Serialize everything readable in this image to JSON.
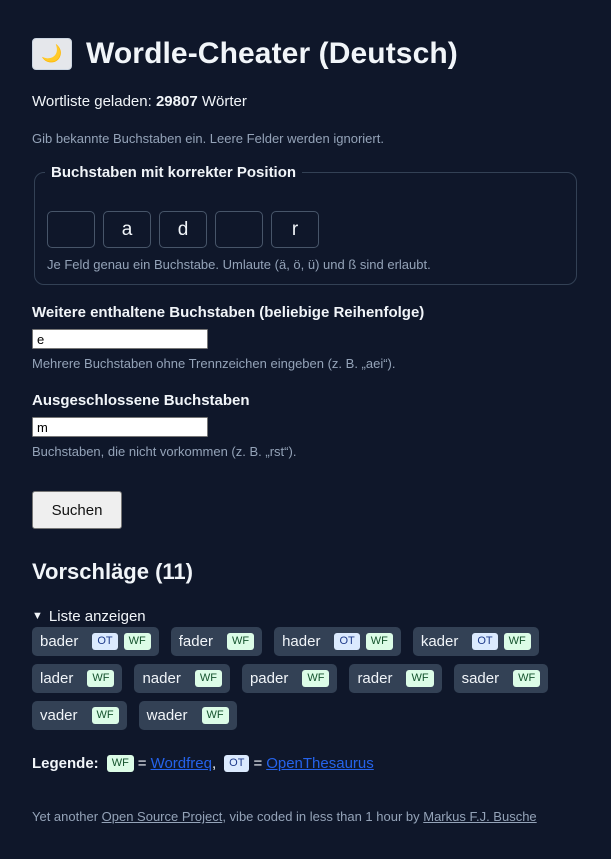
{
  "header": {
    "icon": "moon-icon",
    "icon_glyph": "🌙",
    "title": "Wordle-Cheater (Deutsch)"
  },
  "wordlist": {
    "prefix": "Wortliste geladen: ",
    "count": "29807",
    "suffix": " Wörter"
  },
  "instructions": "Gib bekannte Buchstaben ein. Leere Felder werden ignoriert.",
  "positions": {
    "legend": "Buchstaben mit korrekter Position",
    "slots": [
      "",
      "a",
      "d",
      "",
      "r"
    ],
    "hint": "Je Feld genau ein Buchstabe. Umlaute (ä, ö, ü) und ß sind erlaubt."
  },
  "included": {
    "label": "Weitere enthaltene Buchstaben (beliebige Reihenfolge)",
    "value": "e",
    "hint": "Mehrere Buchstaben ohne Trennzeichen eingeben (z. B. „aei“)."
  },
  "excluded": {
    "label": "Ausgeschlossene Buchstaben",
    "value": "m",
    "hint": "Buchstaben, die nicht vorkommen (z. B. „rst“)."
  },
  "search_button": "Suchen",
  "results": {
    "heading": "Vorschläge (11)",
    "toggle": "Liste anzeigen",
    "words": [
      {
        "word": "bader",
        "badges": [
          "OT",
          "WF"
        ]
      },
      {
        "word": "fader",
        "badges": [
          "WF"
        ]
      },
      {
        "word": "hader",
        "badges": [
          "OT",
          "WF"
        ]
      },
      {
        "word": "kader",
        "badges": [
          "OT",
          "WF"
        ]
      },
      {
        "word": "lader",
        "badges": [
          "WF"
        ]
      },
      {
        "word": "nader",
        "badges": [
          "WF"
        ]
      },
      {
        "word": "pader",
        "badges": [
          "WF"
        ]
      },
      {
        "word": "rader",
        "badges": [
          "WF"
        ]
      },
      {
        "word": "sader",
        "badges": [
          "WF"
        ]
      },
      {
        "word": "vader",
        "badges": [
          "WF"
        ]
      },
      {
        "word": "wader",
        "badges": [
          "WF"
        ]
      }
    ]
  },
  "legend": {
    "label": "Legende:",
    "wf_badge": "WF",
    "wf_link": "Wordfreq",
    "ot_badge": "OT",
    "ot_link": "OpenThesaurus",
    "equals": "=",
    "comma": ","
  },
  "footer": {
    "prefix": "Yet another ",
    "project_link": "Open Source Project",
    "middle": ", vibe coded in less than 1 hour by ",
    "author_link": "Markus F.J. Busche"
  },
  "colors": {
    "background": "#0f172a",
    "chip": "#334155",
    "badge_ot": "#dbeafe",
    "badge_wf": "#dcfce7",
    "link": "#2563eb"
  }
}
